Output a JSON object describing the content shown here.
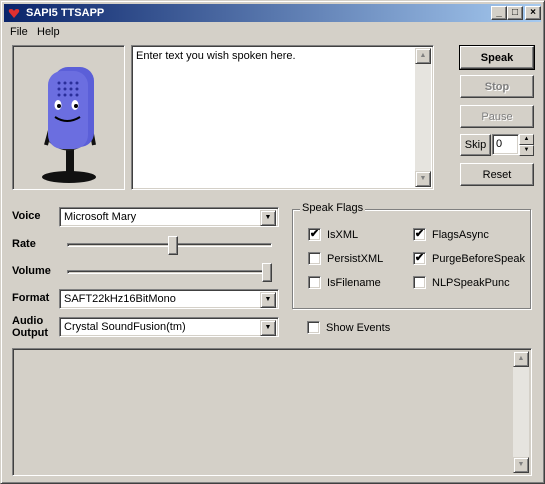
{
  "window": {
    "title": "SAPI5 TTSAPP",
    "minimize_glyph": "_",
    "maximize_glyph": "□",
    "close_glyph": "×"
  },
  "menu": {
    "items": [
      "File",
      "Help"
    ]
  },
  "text_input": {
    "value": "Enter text you wish spoken here."
  },
  "buttons": {
    "speak": "Speak",
    "stop": "Stop",
    "pause": "Pause",
    "skip": "Skip",
    "reset": "Reset"
  },
  "skip_count": "0",
  "controls": {
    "voice": {
      "label": "Voice",
      "value": "Microsoft Mary"
    },
    "rate": {
      "label": "Rate",
      "level": 0.52
    },
    "volume": {
      "label": "Volume",
      "level": 1.0
    },
    "format": {
      "label": "Format",
      "value": "SAFT22kHz16BitMono"
    },
    "audio_output": {
      "label_line1": "Audio",
      "label_line2": "Output",
      "value": "Crystal SoundFusion(tm)"
    }
  },
  "speak_flags": {
    "title": "Speak Flags",
    "items": [
      {
        "label": "IsXML",
        "checked": true
      },
      {
        "label": "FlagsAsync",
        "checked": true
      },
      {
        "label": "PersistXML",
        "checked": false
      },
      {
        "label": "PurgeBeforeSpeak",
        "checked": true
      },
      {
        "label": "IsFilename",
        "checked": false
      },
      {
        "label": "NLPSpeakPunc",
        "checked": false
      }
    ]
  },
  "show_events": {
    "label": "Show Events",
    "checked": false
  },
  "icons": {
    "app": "microphone-heart-icon",
    "mascot": "microphone-character-icon",
    "scroll_up": "scroll-up-arrow-icon",
    "scroll_down": "scroll-down-arrow-icon",
    "dropdown": "chevron-down-icon"
  },
  "colors": {
    "title_bar_start": "#0a246a",
    "title_bar_end": "#a6caf0",
    "mascot_body": "#6b6ee0"
  }
}
